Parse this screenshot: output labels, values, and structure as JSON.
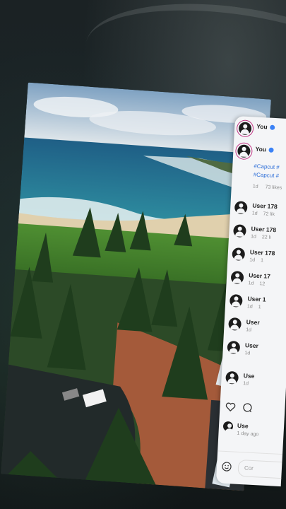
{
  "post": {
    "author": "You",
    "reply_author": "You",
    "hashtags": [
      "#Capcut #",
      "#Capcut #"
    ],
    "time": "1d",
    "likes": "73 likes"
  },
  "comments": [
    {
      "user": "User 178",
      "time": "1d",
      "likes": "72 lik"
    },
    {
      "user": "User 178",
      "time": "1d",
      "likes": "22 li"
    },
    {
      "user": "User 178",
      "time": "1d",
      "likes": "1"
    },
    {
      "user": "User 17",
      "time": "1d",
      "likes": "12"
    },
    {
      "user": "User 1",
      "time": "1d",
      "likes": "1"
    },
    {
      "user": "User",
      "time": "1d",
      "likes": ""
    },
    {
      "user": "User",
      "time": "1d",
      "likes": ""
    },
    {
      "user": "Use",
      "time": "1d",
      "likes": ""
    }
  ],
  "footer": {
    "liked_by": "Use",
    "posted": "1 day ago",
    "comment_placeholder": "Cor"
  },
  "colors": {
    "accent": "#2e6fd8",
    "story_ring": "#c13584",
    "panel_bg": "#f4f5f7"
  },
  "icons": [
    "avatar-icon",
    "verified-badge-icon",
    "heart-icon",
    "comment-icon",
    "emoji-icon"
  ]
}
